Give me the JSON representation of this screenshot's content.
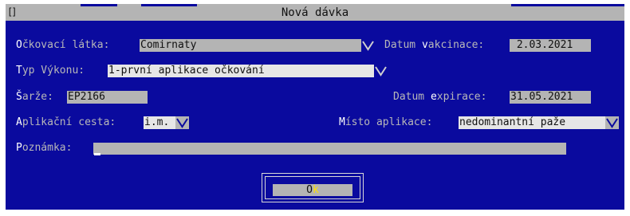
{
  "dialog": {
    "title": "Nová dávka",
    "close_box": "[]"
  },
  "vaccine": {
    "label_hotkey": "O",
    "label_rest": "čkovací látka:",
    "value": "Comirnaty"
  },
  "vaccination_date": {
    "label_pre": "Datum ",
    "label_hotkey": "v",
    "label_post": "akcinace:",
    "value": " 2.03.2021"
  },
  "procedure_type": {
    "label_hotkey": "T",
    "label_rest": "yp Výkonu:",
    "value": "1-první aplikace očkování"
  },
  "batch": {
    "label_hotkey": "Š",
    "label_rest": "arže:",
    "value": "EP2166"
  },
  "expiry_date": {
    "label_pre": "Datum ",
    "label_hotkey": "e",
    "label_post": "xpirace:",
    "value": "31.05.2021"
  },
  "route": {
    "label_hotkey": "A",
    "label_rest": "plikační cesta:",
    "value": "i.m."
  },
  "site": {
    "label_hotkey": "M",
    "label_rest": "ísto aplikace:",
    "value": "nedominantní paže"
  },
  "note": {
    "label_hotkey": "P",
    "label_rest": "oznámka:",
    "value": ""
  },
  "ok_button": {
    "label_pre": "O",
    "label_hotkey": "k"
  },
  "colors": {
    "dialog_bg": "#0a0a9e",
    "field_bg": "#b4b4b4",
    "label_text": "#b8b8b8",
    "hotkey_text": "#ffffff",
    "button_hotkey": "#ffe000"
  },
  "icons": {
    "dropdown": "chevron-down-icon"
  }
}
